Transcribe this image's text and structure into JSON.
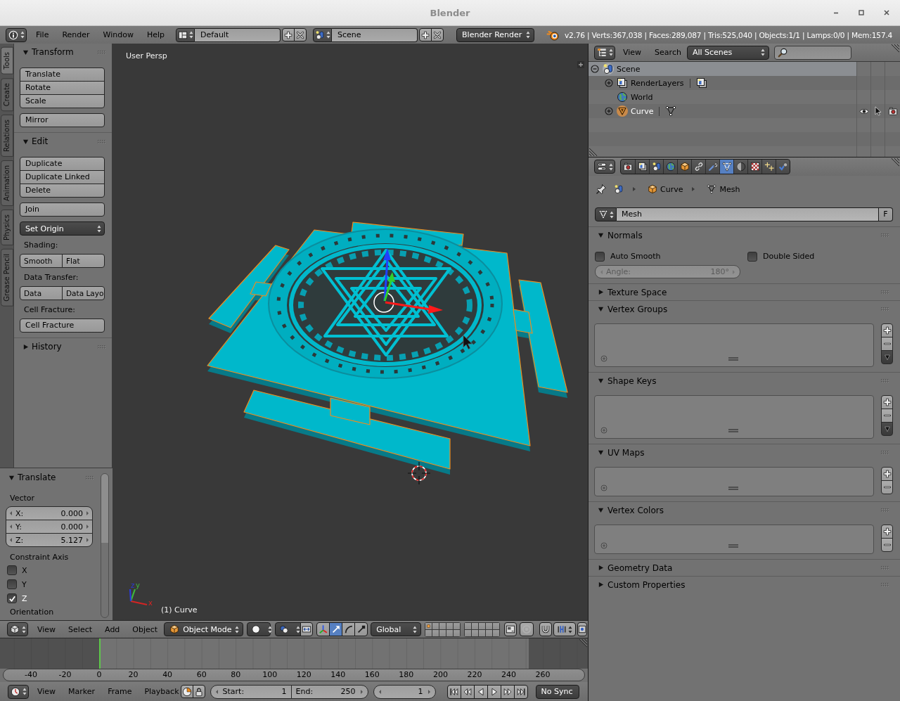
{
  "window": {
    "title": "Blender"
  },
  "info_header": {
    "menus": [
      "File",
      "Render",
      "Window",
      "Help"
    ],
    "layout": "Default",
    "scene": "Scene",
    "engine": "Blender Render",
    "stats": "v2.76 | Verts:367,038 | Faces:289,087 | Tris:525,040 | Objects:1/1 | Lamps:0/0 | Mem:157.4"
  },
  "tool_tabs": [
    {
      "label": "Tools",
      "selected": true
    },
    {
      "label": "Create",
      "selected": false
    },
    {
      "label": "Relations",
      "selected": false
    },
    {
      "label": "Animation",
      "selected": false
    },
    {
      "label": "Physics",
      "selected": false
    },
    {
      "label": "Grease Pencil",
      "selected": false
    }
  ],
  "tool_panels": [
    {
      "title": "Transform",
      "expanded": true,
      "content": [
        {
          "kind": "stack",
          "buttons": [
            "Translate",
            "Rotate",
            "Scale"
          ]
        },
        {
          "kind": "stack",
          "buttons": [
            "Mirror"
          ]
        }
      ]
    },
    {
      "title": "Edit",
      "expanded": true,
      "content": [
        {
          "kind": "stack",
          "buttons": [
            "Duplicate",
            "Duplicate Linked",
            "Delete"
          ]
        },
        {
          "kind": "stack",
          "buttons": [
            "Join"
          ]
        },
        {
          "kind": "dropdown",
          "value": "Set Origin"
        },
        {
          "kind": "label",
          "text": "Shading:"
        },
        {
          "kind": "row",
          "buttons": [
            "Smooth",
            "Flat"
          ]
        },
        {
          "kind": "label",
          "text": "Data Transfer:"
        },
        {
          "kind": "row",
          "buttons": [
            "Data",
            "Data Layo"
          ]
        },
        {
          "kind": "label",
          "text": "Cell Fracture:"
        },
        {
          "kind": "stack",
          "buttons": [
            "Cell Fracture"
          ]
        }
      ]
    },
    {
      "title": "History",
      "expanded": false
    }
  ],
  "operator": {
    "title": "Translate",
    "expanded": true,
    "vector_label": "Vector",
    "vector": [
      {
        "label": "X:",
        "value": "0.000"
      },
      {
        "label": "Y:",
        "value": "0.000"
      },
      {
        "label": "Z:",
        "value": "5.127"
      }
    ],
    "constraint_label": "Constraint Axis",
    "axes": [
      {
        "label": "X",
        "checked": false
      },
      {
        "label": "Y",
        "checked": false
      },
      {
        "label": "Z",
        "checked": true
      }
    ],
    "orientation_label": "Orientation"
  },
  "viewport": {
    "view_name": "User Persp",
    "object_label": "(1) Curve",
    "axes": [
      {
        "label": "x",
        "color": "#d42424"
      },
      {
        "label": "y",
        "color": "#3cb83c"
      },
      {
        "label": "z",
        "color": "#2a3ad8"
      }
    ]
  },
  "view3d_header": {
    "menus": [
      "View",
      "Select",
      "Add",
      "Object"
    ],
    "mode": "Object Mode",
    "manipulators": [
      {
        "kind": "translate",
        "selected": true
      },
      {
        "kind": "rotate",
        "selected": false
      },
      {
        "kind": "scale",
        "selected": false
      }
    ],
    "orientation": "Global",
    "layers": [
      {
        "used": true
      },
      {
        "used": false
      },
      {
        "used": false
      },
      {
        "used": false
      },
      {
        "used": false
      },
      {
        "used": false
      },
      {
        "used": false
      },
      {
        "used": false
      },
      {
        "used": false
      },
      {
        "used": false
      },
      {
        "used": false
      },
      {
        "used": false
      },
      {
        "used": false
      },
      {
        "used": false
      },
      {
        "used": false
      },
      {
        "used": false
      },
      {
        "used": false
      },
      {
        "used": false
      },
      {
        "used": false
      },
      {
        "used": false
      }
    ]
  },
  "timeline": {
    "ruler": [
      "-40",
      "-20",
      "0",
      "20",
      "40",
      "60",
      "80",
      "100",
      "120",
      "140",
      "160",
      "180",
      "200",
      "220",
      "240",
      "260"
    ],
    "menus": [
      "View",
      "Marker",
      "Frame",
      "Playback"
    ],
    "start_label": "Start:",
    "start": "1",
    "end_label": "End:",
    "end": "250",
    "frame": "1",
    "sync": "No Sync"
  },
  "outliner": {
    "menus": [
      "View",
      "Search"
    ],
    "display": "All Scenes",
    "tree": [
      {
        "label": "Scene",
        "kind": "scene",
        "expanded": true,
        "selected": true,
        "active": false,
        "children": [
          {
            "label": "RenderLayers",
            "kind": "render_layers",
            "expanded": false,
            "selected": false,
            "active": false,
            "link": {
              "kind": "render_layers"
            }
          },
          {
            "label": "World",
            "kind": "world",
            "selected": false,
            "active": false
          },
          {
            "label": "Curve",
            "kind": "object",
            "expanded": false,
            "selected": false,
            "active": true,
            "link": {
              "kind": "mesh"
            },
            "restrict": {
              "visible": true,
              "selectable": true,
              "renderable": true
            }
          }
        ]
      }
    ]
  },
  "properties": {
    "tabs": [
      {
        "kind": "render",
        "selected": false
      },
      {
        "kind": "render_layers",
        "selected": false
      },
      {
        "kind": "scene",
        "selected": false
      },
      {
        "kind": "world",
        "selected": false
      },
      {
        "kind": "object",
        "selected": false
      },
      {
        "kind": "constraints",
        "selected": false
      },
      {
        "kind": "modifiers",
        "selected": false
      },
      {
        "kind": "data",
        "selected": true
      },
      {
        "kind": "material",
        "selected": false
      },
      {
        "kind": "texture",
        "selected": false
      },
      {
        "kind": "particles",
        "selected": false
      },
      {
        "kind": "physics",
        "selected": false
      }
    ],
    "breadcrumb": [
      {
        "kind": "scene"
      },
      {
        "kind": "object",
        "label": "Curve"
      },
      {
        "kind": "mesh",
        "label": "Mesh"
      }
    ],
    "datablock": {
      "value": "Mesh",
      "fake_user_label": "F"
    },
    "panels": [
      {
        "title": "Normals",
        "expanded": true,
        "kind": "normals",
        "checks": [
          {
            "label": "Auto Smooth",
            "checked": false
          },
          {
            "label": "Double Sided",
            "checked": false
          }
        ],
        "angle": {
          "label": "Angle:",
          "value": "180°",
          "disabled": true
        }
      },
      {
        "title": "Texture Space",
        "expanded": false
      },
      {
        "title": "Vertex Groups",
        "expanded": true,
        "kind": "list",
        "specials": true
      },
      {
        "title": "Shape Keys",
        "expanded": true,
        "kind": "list",
        "specials": true
      },
      {
        "title": "UV Maps",
        "expanded": true,
        "kind": "list",
        "specials": false
      },
      {
        "title": "Vertex Colors",
        "expanded": true,
        "kind": "list",
        "specials": false
      },
      {
        "title": "Geometry Data",
        "expanded": false
      },
      {
        "title": "Custom Properties",
        "expanded": false
      }
    ]
  }
}
